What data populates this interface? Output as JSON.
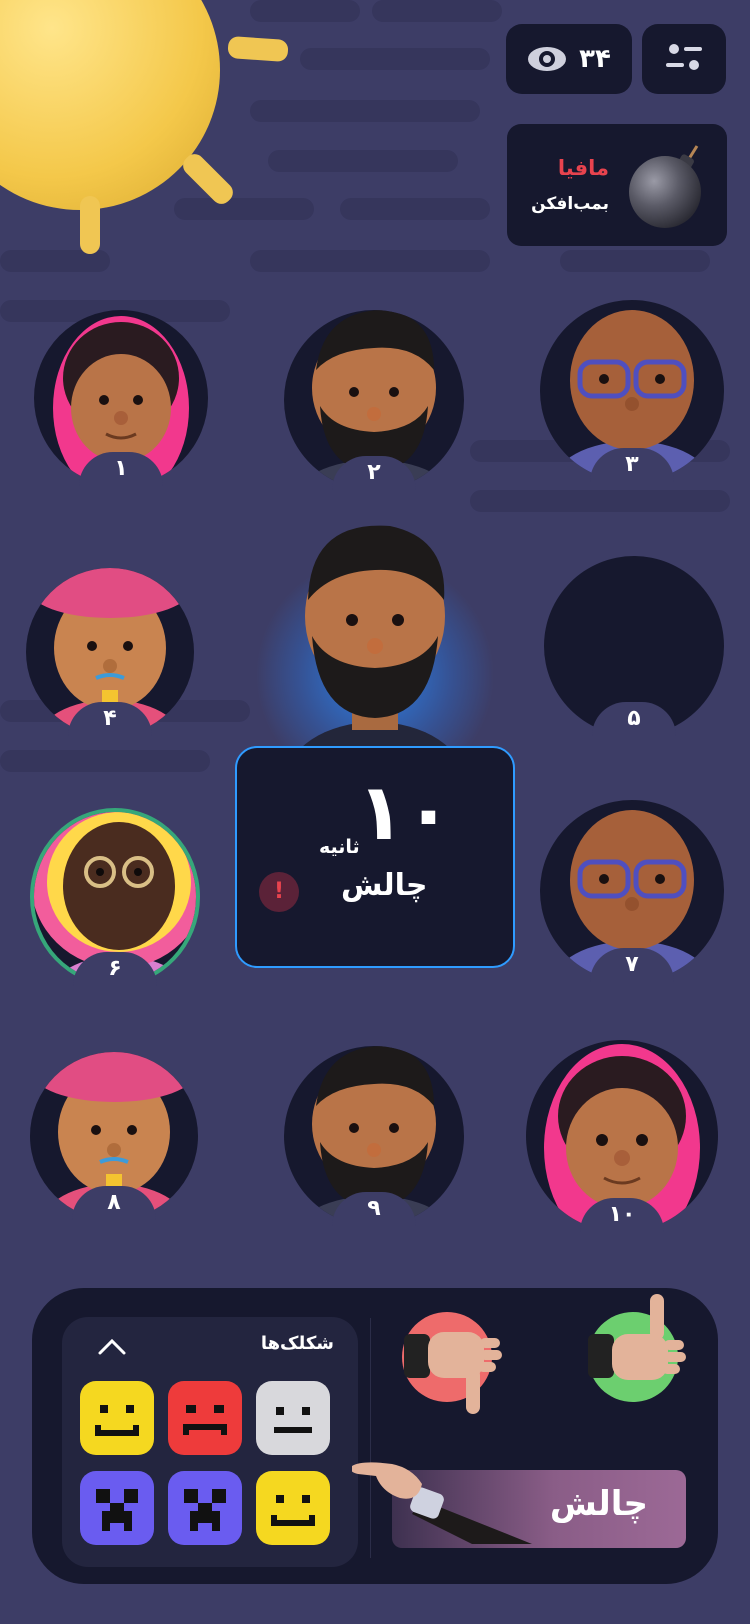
{
  "header": {
    "viewer_count": "۳۴",
    "eye_icon": "eye-icon",
    "settings_icon": "sliders-icon"
  },
  "role": {
    "title": "مافیا",
    "subtitle": "بمب‌افکن",
    "icon": "bomb-icon"
  },
  "players": [
    {
      "number": "۱"
    },
    {
      "number": "۲"
    },
    {
      "number": "۳"
    },
    {
      "number": "۴"
    },
    {
      "number": "۵"
    },
    {
      "number": "۶"
    },
    {
      "number": "۷"
    },
    {
      "number": "۸"
    },
    {
      "number": "۹"
    },
    {
      "number": "۱۰"
    }
  ],
  "timer": {
    "value": "۱۰",
    "unit": "ثانیه",
    "label": "چالش",
    "alert_symbol": "!"
  },
  "emoji_panel": {
    "title": "شکلک‌ها",
    "collapse_icon": "chevron-up-icon",
    "emojis": [
      "smile-yellow",
      "angry-red",
      "neutral-gray",
      "creeper-blue",
      "creeper-blue",
      "smile-yellow"
    ]
  },
  "actions": {
    "dislike_icon": "thumbs-down-icon",
    "like_icon": "thumbs-up-icon",
    "challenge_label": "چالش"
  },
  "colors": {
    "background": "#3d3d66",
    "card": "#16182e",
    "accent_red": "#e8434e",
    "accent_blue": "#2f9bff",
    "like_green": "#6ccf6f",
    "dislike_red": "#ee6b6b"
  }
}
